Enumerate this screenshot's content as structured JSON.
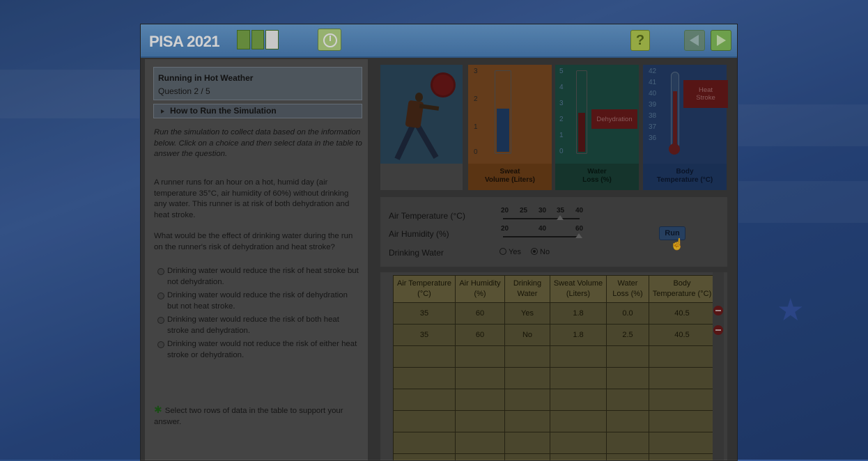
{
  "app": {
    "title": "PISA 2021"
  },
  "question": {
    "title": "Running in Hot Weather",
    "number": "Question 2 / 5",
    "howto": "How to Run the Simulation",
    "instructions": "Run the simulation to collect data based on the information below. Click on a choice and then select data in the table to answer the question.",
    "scenario": "A runner runs for an hour on a hot, humid day (air temperature 35°C, air humidity of 60%) without drinking any water. This runner is at risk of both dehydration and heat stroke.",
    "prompt": "What would be the effect of drinking water during the run on the runner's risk of dehydration and heat stroke?",
    "options": [
      "Drinking water would reduce the risk of heat stroke but not dehydration.",
      "Drinking water would reduce the risk of dehydration but not heat stroke.",
      "Drinking water would reduce the risk of both heat stroke and dehydration.",
      "Drinking water would not reduce the risk of either heat stroke or dehydration."
    ],
    "select_instruction": "Select two rows of data in the table to support your answer."
  },
  "gauges": {
    "sweat": {
      "label_1": "Sweat",
      "label_2": "Volume (Liters)",
      "ticks": [
        "3",
        "2",
        "1",
        "0"
      ],
      "level": 0.55
    },
    "water": {
      "label_1": "Water",
      "label_2": "Loss (%)",
      "ticks": [
        "5",
        "4",
        "3",
        "2",
        "1",
        "0"
      ],
      "level": 0.5,
      "tag": "Dehydration"
    },
    "body": {
      "label_1": "Body",
      "label_2": "Temperature (°C)",
      "ticks": [
        "42",
        "41",
        "40",
        "39",
        "38",
        "37",
        "36"
      ],
      "level": 0.78,
      "tag_1": "Heat",
      "tag_2": "Stroke"
    }
  },
  "controls": {
    "air_temp": {
      "label": "Air Temperature (°C)",
      "scale": [
        "20",
        "25",
        "30",
        "35",
        "40"
      ],
      "value": "35"
    },
    "humidity": {
      "label": "Air Humidity (%)",
      "scale": [
        "20",
        "40",
        "60"
      ],
      "value": "60"
    },
    "drinking": {
      "label": "Drinking Water",
      "yes": "Yes",
      "no": "No",
      "selected": "No"
    },
    "run_label": "Run"
  },
  "table": {
    "headers": [
      {
        "line1": "Air Temperature",
        "line2": "(°C)"
      },
      {
        "line1": "Air Humidity",
        "line2": "(%)"
      },
      {
        "line1": "Drinking",
        "line2": "Water"
      },
      {
        "line1": "Sweat Volume",
        "line2": "(Liters)"
      },
      {
        "line1": "Water",
        "line2": "Loss (%)"
      },
      {
        "line1": "Body",
        "line2": "Temperature (°C)"
      }
    ],
    "rows": [
      [
        "35",
        "60",
        "Yes",
        "1.8",
        "0.0",
        "40.5"
      ],
      [
        "35",
        "60",
        "No",
        "1.8",
        "2.5",
        "40.5"
      ]
    ],
    "empty_rows": 6
  },
  "colors": {
    "topbar": "#4e83bd",
    "progress": "#7aa84a",
    "nav_next": "#86c25c"
  }
}
